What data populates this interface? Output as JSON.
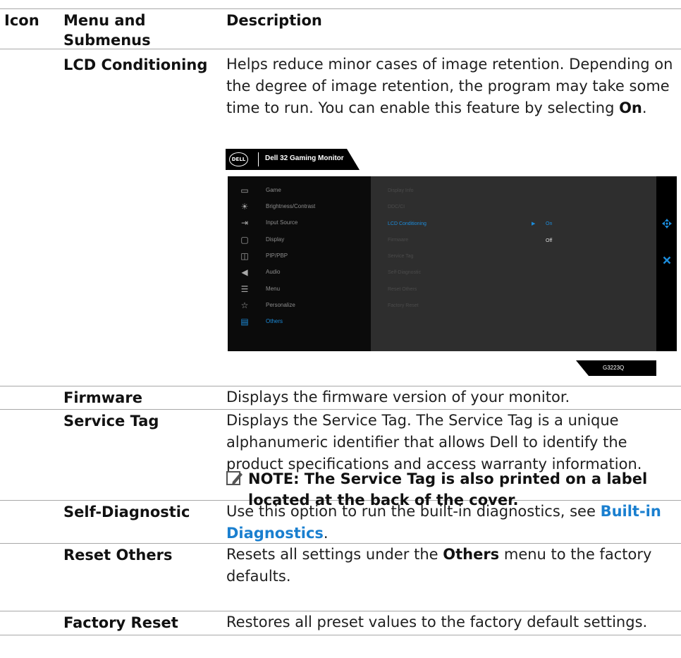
{
  "headers": {
    "icon": "Icon",
    "menu": "Menu and Submenus",
    "description": "Description"
  },
  "lcd": {
    "name": "LCD Conditioning",
    "desc_1": "Helps reduce minor cases of image retention. Depending on the degree of image retention, the program may take some time to run. You can enable this feature by selecting ",
    "desc_bold": "On",
    "desc_end": "."
  },
  "osd": {
    "logo": "DELL",
    "title": "Dell 32 Gaming Monitor",
    "menu": [
      {
        "label": "Game",
        "icon": "game-icon"
      },
      {
        "label": "Brightness/Contrast",
        "icon": "brightness-icon"
      },
      {
        "label": "Input Source",
        "icon": "input-source-icon"
      },
      {
        "label": "Display",
        "icon": "display-icon"
      },
      {
        "label": "PIP/PBP",
        "icon": "pip-pbp-icon"
      },
      {
        "label": "Audio",
        "icon": "audio-icon"
      },
      {
        "label": "Menu",
        "icon": "menu-icon"
      },
      {
        "label": "Personalize",
        "icon": "star-icon"
      },
      {
        "label": "Others",
        "icon": "others-icon"
      }
    ],
    "active_menu": "Others",
    "submenu": [
      "Display Info",
      "DDC/CI",
      "LCD Conditioning",
      "Firmware",
      "Service Tag",
      "Self-Diagnostic",
      "Reset Others",
      "Factory Reset"
    ],
    "active_submenu": "LCD Conditioning",
    "options": [
      "On",
      "Off"
    ],
    "selected_option": "On",
    "model": "G3223Q",
    "accent": "#1c8cdb"
  },
  "firmware": {
    "name": "Firmware",
    "desc": "Displays the firmware version of your monitor."
  },
  "service_tag": {
    "name": "Service Tag",
    "desc": "Displays the Service Tag. The Service Tag is a unique alphanumeric identifier that allows Dell to identify the product specifications and access warranty information.",
    "note": "NOTE: The Service Tag is also printed on a label located at the back of the cover."
  },
  "self_diag": {
    "name": "Self-Diagnostic",
    "desc_1": "Use this option to run the built-in diagnostics, see ",
    "link": "Built-in Diagnostics",
    "desc_end": "."
  },
  "reset_others": {
    "name": "Reset Others",
    "desc_1": "Resets all settings under the ",
    "desc_bold": "Others",
    "desc_end": " menu to the factory defaults."
  },
  "factory_reset": {
    "name": "Factory Reset",
    "desc": "Restores all preset values to the factory default settings."
  }
}
